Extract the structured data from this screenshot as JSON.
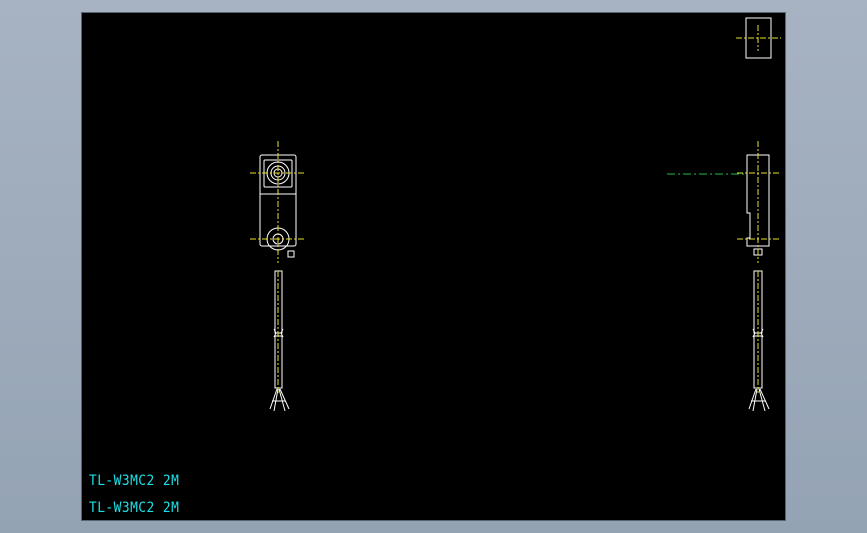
{
  "labels": [
    "TL-W3MC2 2M",
    "TL-W3MC2 2M"
  ],
  "colors": {
    "background": "#000000",
    "outline": "#ffffff",
    "centerline": "#e8e22a",
    "dimension": "#22b84a",
    "text": "#1de0e6"
  }
}
